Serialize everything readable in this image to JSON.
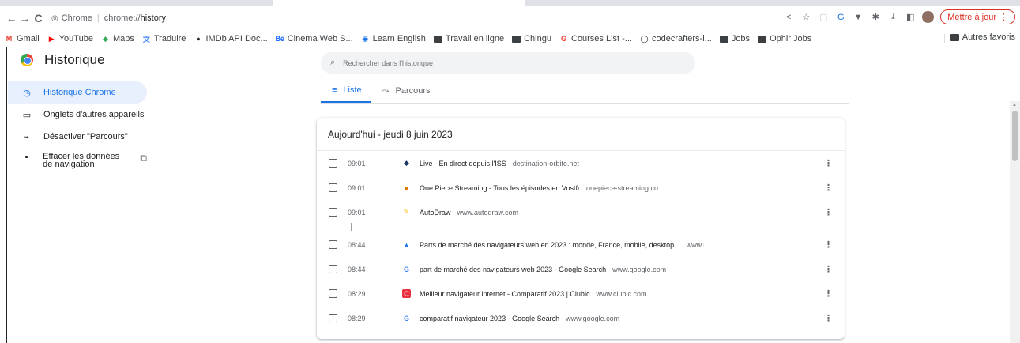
{
  "browser": {
    "omnibox": {
      "site_label": "Chrome",
      "host": "chrome://",
      "path": "history"
    },
    "update_button": "Mettre à jour",
    "bookmarks": [
      {
        "label": "Gmail",
        "icon": "gmail-icon",
        "color": "#ea4335"
      },
      {
        "label": "YouTube",
        "icon": "youtube-icon",
        "color": "#ff0000"
      },
      {
        "label": "Maps",
        "icon": "maps-icon",
        "color": "#34a853"
      },
      {
        "label": "Traduire",
        "icon": "translate-icon",
        "color": "#4285f4"
      },
      {
        "label": "IMDb API Doc...",
        "icon": "imdb-icon",
        "color": "#202124"
      },
      {
        "label": "Cinema Web S...",
        "icon": "behance-icon",
        "color": "#1769ff"
      },
      {
        "label": "Learn English",
        "icon": "learn-english-icon",
        "color": "#1a73e8"
      },
      {
        "label": "Travail en ligne",
        "icon": "folder-icon",
        "color": "#3c4043"
      },
      {
        "label": "Chingu",
        "icon": "folder-icon",
        "color": "#3c4043"
      },
      {
        "label": "Courses List -...",
        "icon": "google-icon",
        "color": "#ea4335"
      },
      {
        "label": "codecrafters-i...",
        "icon": "github-icon",
        "color": "#202124"
      },
      {
        "label": "Jobs",
        "icon": "folder-icon",
        "color": "#3c4043"
      },
      {
        "label": "Ophir Jobs",
        "icon": "folder-icon",
        "color": "#3c4043"
      }
    ],
    "other_bookmarks": "Autres favoris"
  },
  "app": {
    "title": "Historique"
  },
  "sidebar": {
    "items": [
      {
        "label": "Historique Chrome",
        "icon": "clock-icon",
        "active": true
      },
      {
        "label": "Onglets d'autres appareils",
        "icon": "devices-icon"
      },
      {
        "label": "Désactiver \"Parcours\"",
        "icon": "journeys-off-icon"
      },
      {
        "label": "Effacer les données de navigation",
        "icon": "trash-icon"
      }
    ]
  },
  "search": {
    "placeholder": "Rechercher dans l'historique"
  },
  "tabs": [
    {
      "label": "Liste",
      "icon": "list-icon",
      "active": true
    },
    {
      "label": "Parcours",
      "icon": "journeys-icon"
    }
  ],
  "history": {
    "date_header": "Aujourd'hui - jeudi 8 juin 2023",
    "entries": [
      {
        "time": "09:01",
        "title": "Live - En direct depuis l'ISS",
        "domain": "destination-orbite.net",
        "favicon": "orbit-icon",
        "color": "#1a3a6e"
      },
      {
        "time": "09:01",
        "title": "One Piece Streaming - Tous les épisodes en Vostfr",
        "domain": "onepiece-streaming.co",
        "favicon": "onepiece-icon",
        "color": "#e37400"
      },
      {
        "time": "09:01",
        "title": "AutoDraw",
        "domain": "www.autodraw.com",
        "favicon": "autodraw-icon",
        "color": "#fbbc05"
      },
      {
        "time": "08:44",
        "title": "Parts de marché des navigateurs web en 2023 : monde, France, mobile, desktop...",
        "domain": "www.blogdumoderateur.com",
        "favicon": "bdm-icon",
        "color": "#1a73e8"
      },
      {
        "time": "08:44",
        "title": "part de marché des navigateurs web 2023 - Google Search",
        "domain": "www.google.com",
        "favicon": "google-icon",
        "color": "#4285f4"
      },
      {
        "time": "08:29",
        "title": "Meilleur navigateur internet - Comparatif 2023 | Clubic",
        "domain": "www.clubic.com",
        "favicon": "clubic-icon",
        "color": "#e8313f"
      },
      {
        "time": "08:29",
        "title": "comparatif navigateur 2023 - Google Search",
        "domain": "www.google.com",
        "favicon": "google-icon",
        "color": "#4285f4"
      }
    ]
  }
}
